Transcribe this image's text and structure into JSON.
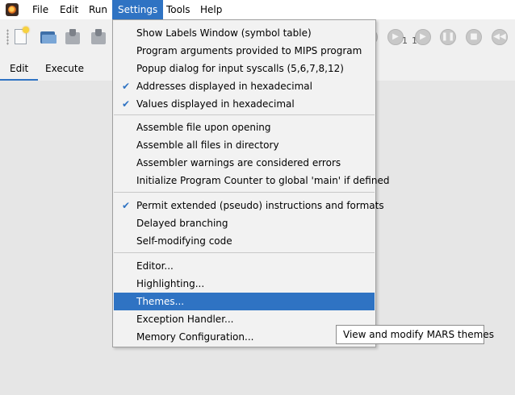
{
  "menubar": {
    "items": [
      "File",
      "Edit",
      "Run",
      "Settings",
      "Tools",
      "Help"
    ]
  },
  "toolbar": {
    "step_count_a": "1",
    "step_count_b": "1"
  },
  "tabs": [
    "Edit",
    "Execute"
  ],
  "settings_menu": {
    "group1": [
      {
        "label": "Show Labels Window (symbol table)",
        "checked": false
      },
      {
        "label": "Program arguments provided to MIPS program",
        "checked": false
      },
      {
        "label": "Popup dialog for input syscalls (5,6,7,8,12)",
        "checked": false
      },
      {
        "label": "Addresses displayed in hexadecimal",
        "checked": true
      },
      {
        "label": "Values displayed in hexadecimal",
        "checked": true
      }
    ],
    "group2": [
      {
        "label": "Assemble file upon opening"
      },
      {
        "label": "Assemble all files in directory"
      },
      {
        "label": "Assembler warnings are considered errors"
      },
      {
        "label": "Initialize Program Counter to global 'main' if defined"
      }
    ],
    "group3": [
      {
        "label": "Permit extended (pseudo) instructions and formats",
        "checked": true
      },
      {
        "label": "Delayed branching",
        "checked": false
      },
      {
        "label": "Self-modifying code",
        "checked": false
      }
    ],
    "group4": [
      {
        "label": "Editor..."
      },
      {
        "label": "Highlighting..."
      },
      {
        "label": "Themes...",
        "highlighted": true
      },
      {
        "label": "Exception Handler..."
      },
      {
        "label": "Memory Configuration..."
      }
    ],
    "check_glyph": "✔"
  },
  "tooltip": "View and modify MARS themes",
  "colors": {
    "accent": "#2f73c3",
    "menu_bg": "#f2f2f2",
    "workspace_bg": "#e6e6e6"
  }
}
